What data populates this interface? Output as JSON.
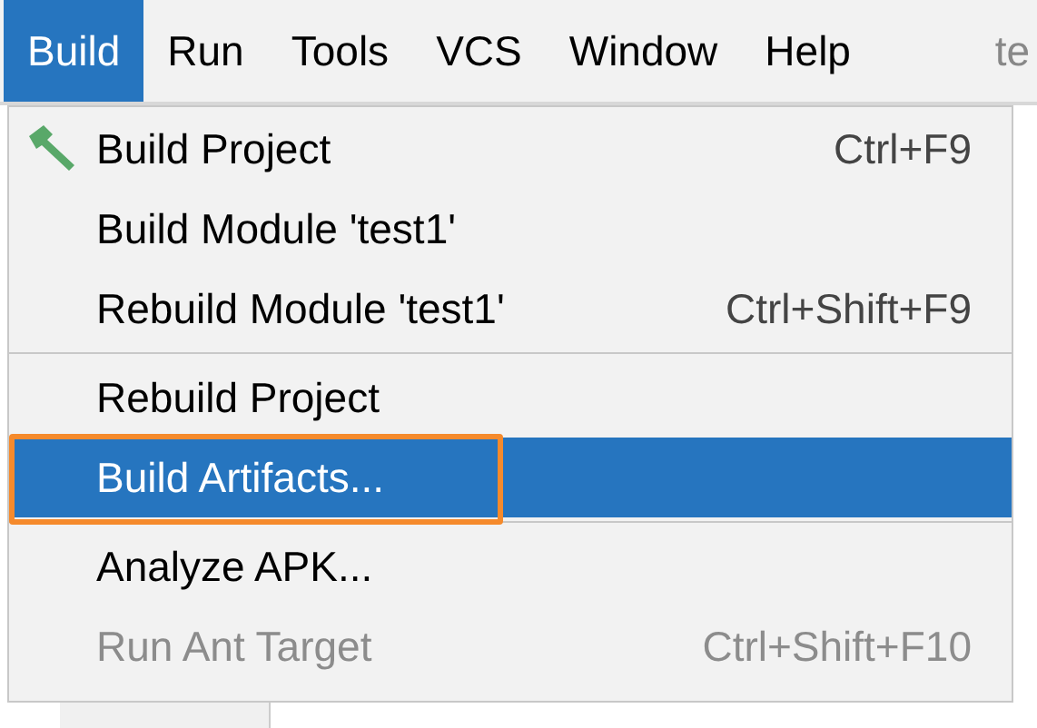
{
  "menubar": {
    "menus": [
      {
        "label": "Build",
        "selected": true
      },
      {
        "label": "Run",
        "selected": false
      },
      {
        "label": "Tools",
        "selected": false
      },
      {
        "label": "VCS",
        "selected": false
      },
      {
        "label": "Window",
        "selected": false
      },
      {
        "label": "Help",
        "selected": false
      }
    ],
    "title": "te"
  },
  "menu": {
    "items": [
      {
        "kind": "item",
        "label": "Build Project",
        "shortcut": "Ctrl+F9",
        "icon": true,
        "selected": false,
        "disabled": false,
        "annotated": false
      },
      {
        "kind": "item",
        "label": "Build Module 'test1'",
        "selected": false,
        "disabled": false,
        "annotated": false
      },
      {
        "kind": "item",
        "label": "Rebuild Module 'test1'",
        "shortcut": "Ctrl+Shift+F9",
        "selected": false,
        "disabled": false,
        "annotated": false
      },
      {
        "kind": "separator"
      },
      {
        "kind": "item",
        "label": "Rebuild Project",
        "selected": false,
        "disabled": false,
        "annotated": false
      },
      {
        "kind": "item",
        "label": "Build Artifacts...",
        "selected": true,
        "disabled": false,
        "annotated": true
      },
      {
        "kind": "separator"
      },
      {
        "kind": "item",
        "label": "Analyze APK...",
        "selected": false,
        "disabled": false,
        "annotated": false
      },
      {
        "kind": "item",
        "label": "Run Ant Target",
        "shortcut": "Ctrl+Shift+F10",
        "selected": false,
        "disabled": true,
        "annotated": false
      }
    ]
  }
}
